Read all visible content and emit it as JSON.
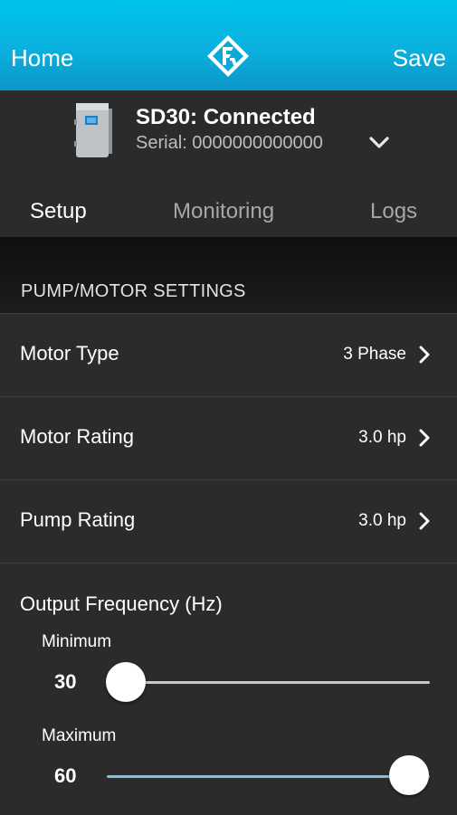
{
  "nav": {
    "home_label": "Home",
    "save_label": "Save",
    "logo_icon": "franklin-logo-icon"
  },
  "device": {
    "title": "SD30: Connected",
    "serial": "Serial: 0000000000000",
    "image_icon": "control-box-icon",
    "expand_icon": "chevron-down-icon"
  },
  "tabs": [
    {
      "label": "Setup",
      "active": true
    },
    {
      "label": "Monitoring",
      "active": false
    },
    {
      "label": "Logs",
      "active": false
    }
  ],
  "section": {
    "title": "PUMP/MOTOR SETTINGS"
  },
  "settings": [
    {
      "label": "Motor Type",
      "value": "3 Phase"
    },
    {
      "label": "Motor Rating",
      "value": "3.0 hp"
    },
    {
      "label": "Pump Rating",
      "value": "3.0 hp"
    }
  ],
  "frequency": {
    "heading": "Output Frequency (Hz)",
    "minimum": {
      "label": "Minimum",
      "value": "30",
      "fraction": 0.0
    },
    "maximum": {
      "label": "Maximum",
      "value": "60",
      "fraction": 1.0
    }
  },
  "colors": {
    "accent": "#00b4e6",
    "slider_active": "#7fc2e0",
    "slider_inactive": "#c8c8c8"
  }
}
